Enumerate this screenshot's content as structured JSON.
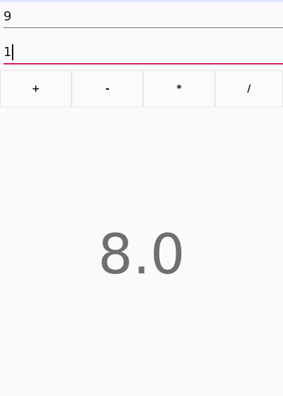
{
  "inputs": {
    "first_value": "9",
    "second_value": "1"
  },
  "operations": [
    {
      "label": "+"
    },
    {
      "label": "-"
    },
    {
      "label": "*"
    },
    {
      "label": "/"
    }
  ],
  "result": {
    "value": "8.0"
  },
  "colors": {
    "accent": "#d81b60",
    "result_text": "#6f6f6f"
  }
}
